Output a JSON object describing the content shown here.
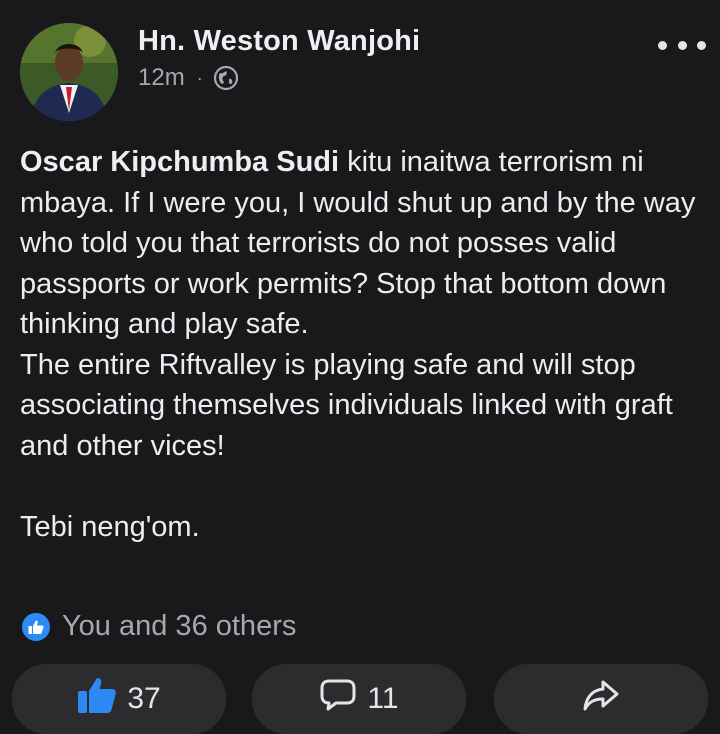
{
  "post": {
    "author": "Hn. Weston Wanjohi",
    "time": "12m",
    "separator": "·",
    "privacy_icon": "globe-icon",
    "tag": "Oscar Kipchumba Sudi",
    "body": " kitu inaitwa terrorism ni mbaya. If I were you, I would shut up and by the way who told you that terrorists do not posses valid passports or work permits? Stop that bottom down thinking and play safe.\nThe entire Riftvalley is playing safe and will stop associating themselves individuals linked with graft and other vices!\n\nTebi neng'om."
  },
  "reactions": {
    "icon": "like-badge-icon",
    "summary": "You and 36 others"
  },
  "actions": {
    "like_count": "37",
    "comment_count": "11",
    "like_color": "#2d8af5"
  }
}
